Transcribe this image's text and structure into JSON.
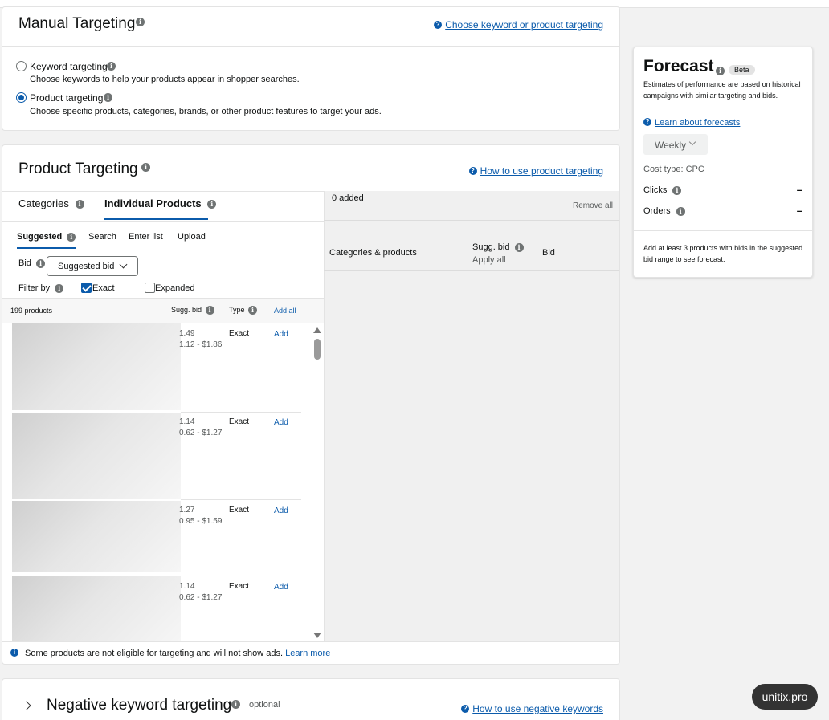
{
  "manual": {
    "title": "Manual Targeting",
    "help_link": "Choose keyword or product targeting",
    "options": [
      {
        "label": "Keyword targeting",
        "desc": "Choose keywords to help your products appear in shopper searches.",
        "checked": false
      },
      {
        "label": "Product targeting",
        "desc": "Choose specific products, categories, brands, or other product features to target your ads.",
        "checked": true
      }
    ]
  },
  "product_targeting": {
    "title": "Product Targeting",
    "help_link": "How to use product targeting",
    "tabs": [
      "Categories",
      "Individual Products"
    ],
    "subtabs": [
      "Suggested",
      "Search",
      "Enter list",
      "Upload"
    ],
    "bid_label": "Bid",
    "bid_select": "Suggested bid",
    "filter_label": "Filter by",
    "filter_exact": "Exact",
    "filter_expanded": "Expanded",
    "list_header": {
      "count": "199 products",
      "sugg_bid": "Sugg. bid",
      "type": "Type",
      "add_all": "Add all"
    },
    "rows": [
      {
        "bid": "1.49",
        "range": "1.12 - $1.86",
        "type": "Exact",
        "action": "Add"
      },
      {
        "bid": "1.14",
        "range": "0.62 - $1.27",
        "type": "Exact",
        "action": "Add"
      },
      {
        "bid": "1.27",
        "range": "0.95 - $1.59",
        "type": "Exact",
        "action": "Add"
      },
      {
        "bid": "1.14",
        "range": "0.62 - $1.27",
        "type": "Exact",
        "action": "Add"
      }
    ],
    "added": {
      "count": "0 added",
      "remove_all": "Remove all",
      "col_items": "Categories & products",
      "col_sugg": "Sugg. bid",
      "apply_all": "Apply all",
      "col_bid": "Bid"
    },
    "footnote": "Some products are not eligible for targeting and will not show ads.",
    "footnote_link": "Learn more"
  },
  "negative": {
    "title": "Negative keyword targeting",
    "optional": "optional",
    "help_link": "How to use negative keywords"
  },
  "forecast": {
    "title": "Forecast",
    "badge": "Beta",
    "desc": "Estimates of performance are based on historical campaigns with similar targeting and bids.",
    "link": "Learn about forecasts",
    "period": "Weekly",
    "cost_type": "Cost type: CPC",
    "metrics": [
      {
        "label": "Clicks",
        "value": "–"
      },
      {
        "label": "Orders",
        "value": "–"
      }
    ],
    "note": "Add at least 3 products with bids in the suggested bid range to see forecast."
  },
  "watermark": "unitix.pro",
  "colors": {
    "accent": "#0b5bab",
    "text": "#0f1111",
    "muted": "#565959",
    "bg": "#f2f2f2"
  }
}
